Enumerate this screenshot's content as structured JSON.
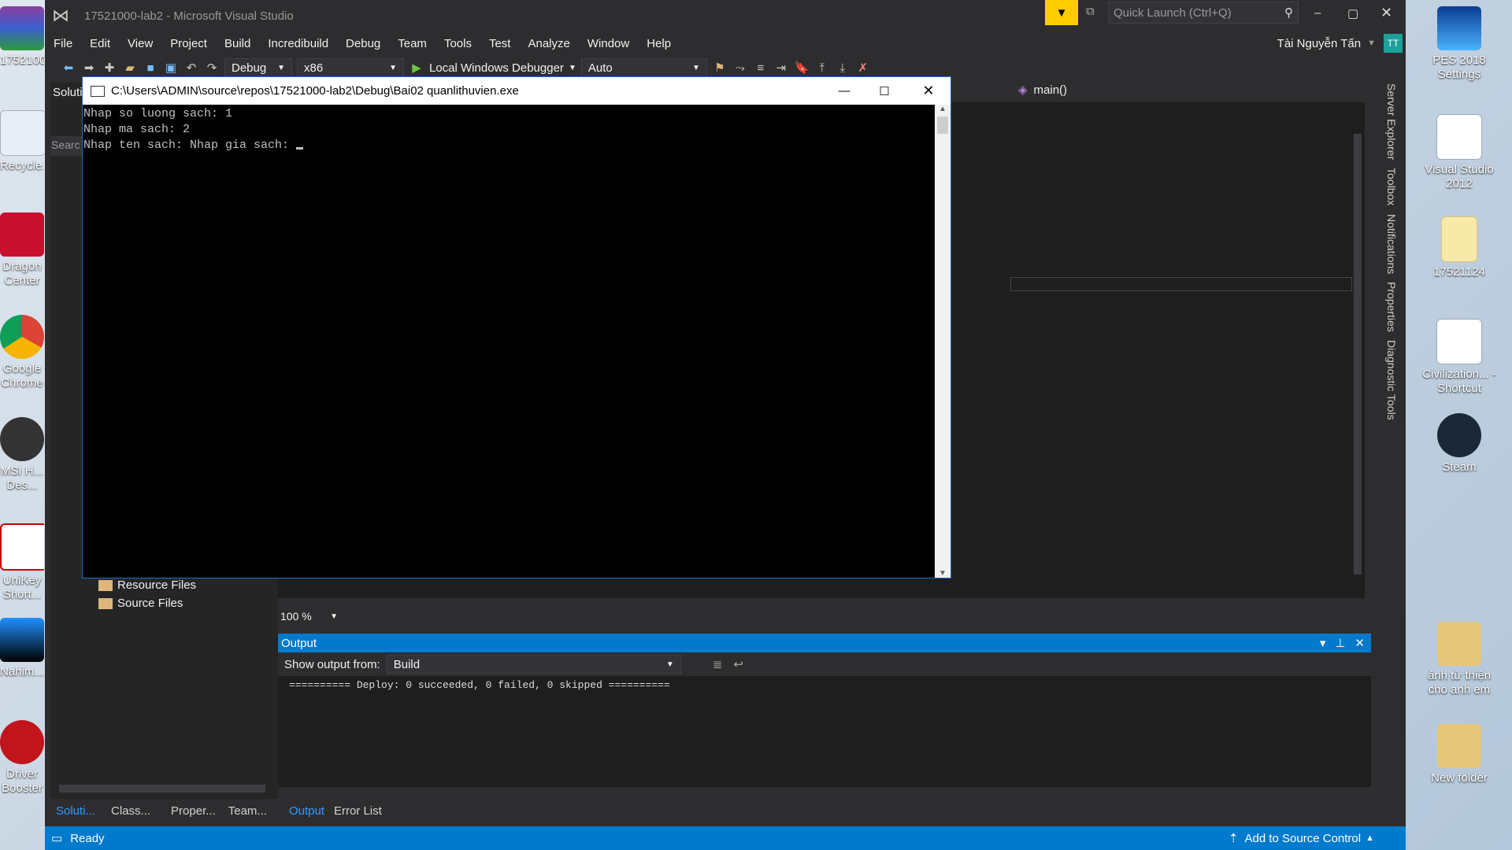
{
  "desktop": {
    "icons_left": [
      {
        "label": "1752100..."
      },
      {
        "label": "Recycle..."
      },
      {
        "label": "Dragon Center"
      },
      {
        "label": "Google Chrome"
      },
      {
        "label": "MSI H... Des..."
      },
      {
        "label": "UniKey Short..."
      },
      {
        "label": "Nahim..."
      },
      {
        "label": "Driver Booster"
      }
    ],
    "icons_right": [
      {
        "label": "PES 2018 Settings"
      },
      {
        "label": "Visual Studio 2012"
      },
      {
        "label": "17521124"
      },
      {
        "label": "Civilization... - Shortcut"
      },
      {
        "label": "Steam"
      },
      {
        "label": "ảnh từ thiện cho anh em"
      },
      {
        "label": "New folder"
      }
    ]
  },
  "vs": {
    "title": "17521000-lab2 - Microsoft Visual Studio",
    "quick_launch_placeholder": "Quick Launch (Ctrl+Q)",
    "user_name": "Tài Nguyễn Tấn",
    "user_initials": "TT",
    "menu": [
      "File",
      "Edit",
      "View",
      "Project",
      "Build",
      "Incredibuild",
      "Debug",
      "Team",
      "Tools",
      "Test",
      "Analyze",
      "Window",
      "Help"
    ],
    "toolbar": {
      "config": "Debug",
      "platform": "x86",
      "debugger": "Local Windows Debugger",
      "auto": "Auto"
    },
    "solution_panel": {
      "title": "Soluti",
      "search_placeholder": "Searc",
      "items": [
        "Resource Files",
        "Source Files"
      ]
    },
    "editor": {
      "function_nav": "main()",
      "zoom": "100 %"
    },
    "right_tabs": [
      "Server Explorer",
      "Toolbox",
      "Notifications",
      "Properties",
      "Diagnostic Tools"
    ],
    "output": {
      "title": "Output",
      "show_from_label": "Show output from:",
      "source": "Build",
      "text": "========== Deploy: 0 succeeded, 0 failed, 0 skipped =========="
    },
    "bottom_tabs_left": [
      "Soluti...",
      "Class...",
      "Proper...",
      "Team..."
    ],
    "bottom_tabs_right": [
      "Output",
      "Error List"
    ],
    "status": {
      "ready": "Ready",
      "source_control": "Add to Source Control"
    }
  },
  "console": {
    "title": "C:\\Users\\ADMIN\\source\\repos\\17521000-lab2\\Debug\\Bai02 quanlithuvien.exe",
    "lines": [
      "Nhap so luong sach: 1",
      "Nhap ma sach: 2",
      "Nhap ten sach: Nhap gia sach: "
    ]
  }
}
